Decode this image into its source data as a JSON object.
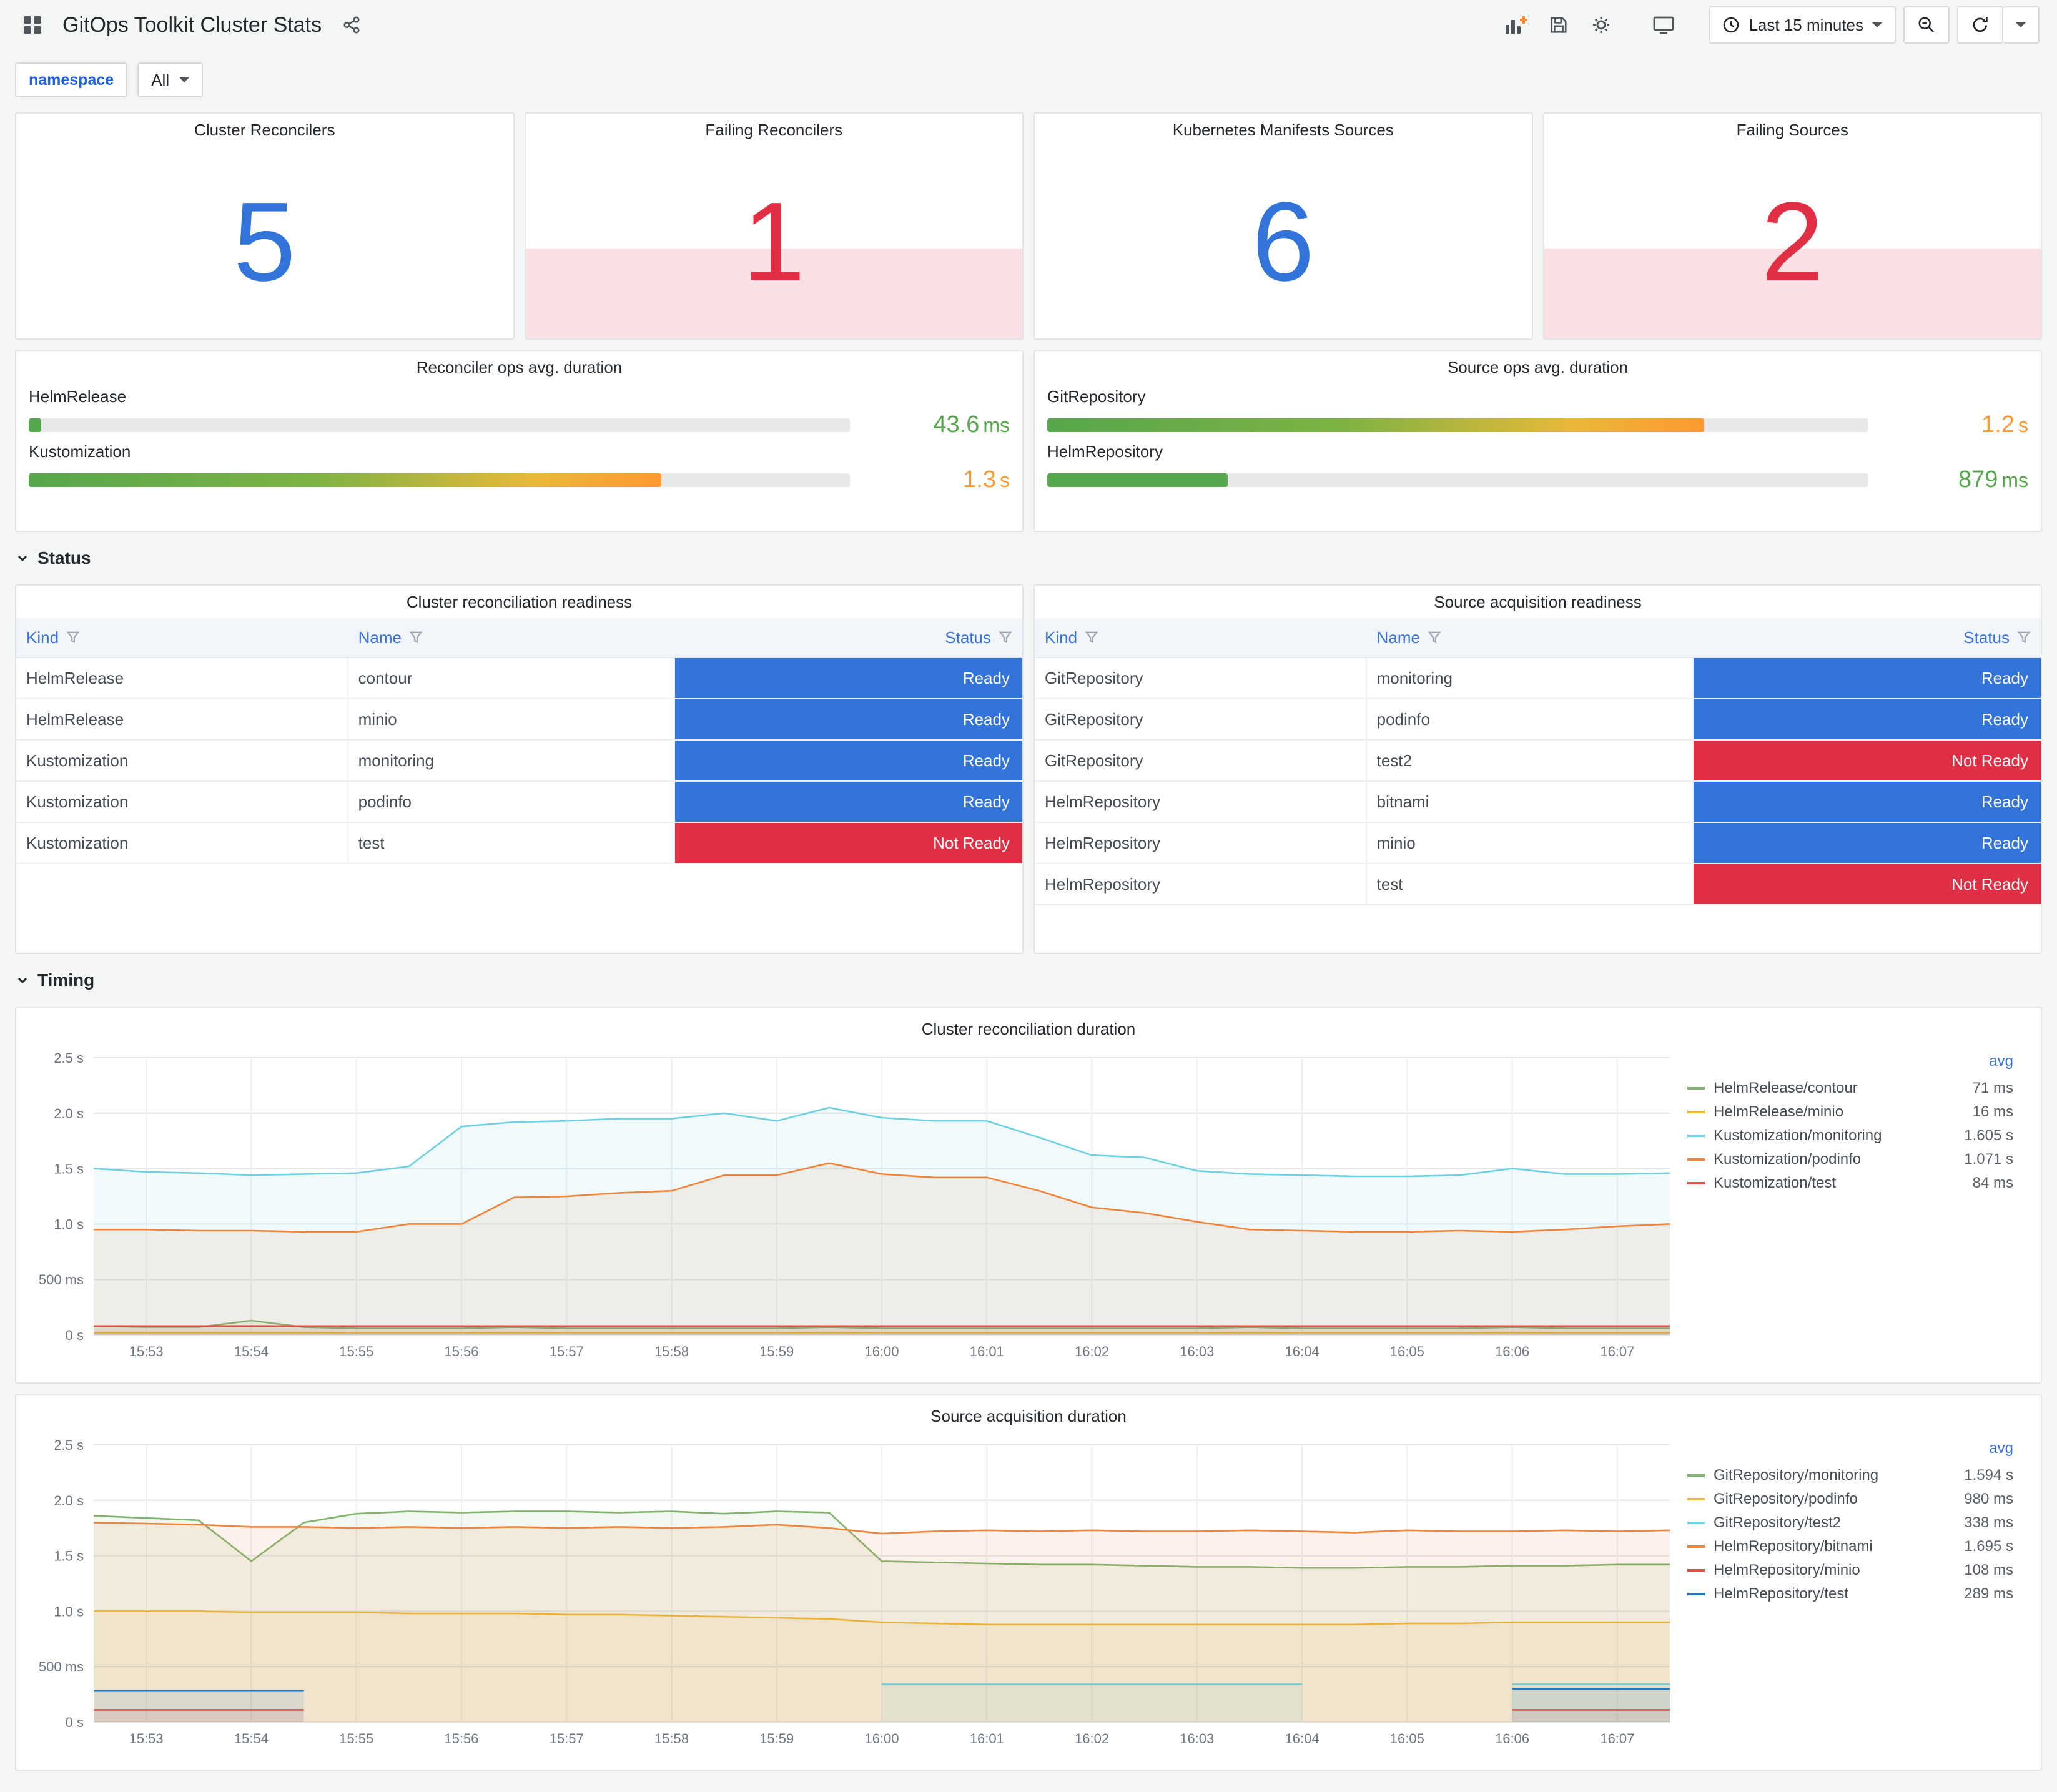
{
  "header": {
    "title": "GitOps Toolkit Cluster Stats",
    "time_label": "Last 15 minutes"
  },
  "variables": {
    "namespace_label": "namespace",
    "namespace_value": "All"
  },
  "stats": [
    {
      "title": "Cluster Reconcilers",
      "value": "5",
      "color": "#3274d9",
      "alert": false
    },
    {
      "title": "Failing Reconcilers",
      "value": "1",
      "color": "#e02f44",
      "alert": true
    },
    {
      "title": "Kubernetes Manifests Sources",
      "value": "6",
      "color": "#3274d9",
      "alert": false
    },
    {
      "title": "Failing Sources",
      "value": "2",
      "color": "#e02f44",
      "alert": true
    }
  ],
  "gauges": [
    {
      "title": "Reconciler ops avg. duration",
      "bars": [
        {
          "label": "HelmRelease",
          "value": "43.6",
          "unit": "ms",
          "pct": 1.5,
          "value_color": "#56a64b"
        },
        {
          "label": "Kustomization",
          "value": "1.3",
          "unit": "s",
          "pct": 77,
          "value_color": "#ff9830"
        }
      ]
    },
    {
      "title": "Source ops avg. duration",
      "bars": [
        {
          "label": "GitRepository",
          "value": "1.2",
          "unit": "s",
          "pct": 80,
          "value_color": "#ff9830"
        },
        {
          "label": "HelmRepository",
          "value": "879",
          "unit": "ms",
          "pct": 22,
          "value_color": "#56a64b"
        }
      ]
    }
  ],
  "sections": {
    "status": "Status",
    "timing": "Timing"
  },
  "status_colors": {
    "Ready": "#3274d9",
    "Not Ready": "#e02f44"
  },
  "tables": [
    {
      "title": "Cluster reconciliation readiness",
      "columns": [
        "Kind",
        "Name",
        "Status"
      ],
      "rows": [
        {
          "kind": "HelmRelease",
          "name": "contour",
          "status": "Ready"
        },
        {
          "kind": "HelmRelease",
          "name": "minio",
          "status": "Ready"
        },
        {
          "kind": "Kustomization",
          "name": "monitoring",
          "status": "Ready"
        },
        {
          "kind": "Kustomization",
          "name": "podinfo",
          "status": "Ready"
        },
        {
          "kind": "Kustomization",
          "name": "test",
          "status": "Not Ready"
        }
      ]
    },
    {
      "title": "Source acquisition readiness",
      "columns": [
        "Kind",
        "Name",
        "Status"
      ],
      "rows": [
        {
          "kind": "GitRepository",
          "name": "monitoring",
          "status": "Ready"
        },
        {
          "kind": "GitRepository",
          "name": "podinfo",
          "status": "Ready"
        },
        {
          "kind": "GitRepository",
          "name": "test2",
          "status": "Not Ready"
        },
        {
          "kind": "HelmRepository",
          "name": "bitnami",
          "status": "Ready"
        },
        {
          "kind": "HelmRepository",
          "name": "minio",
          "status": "Ready"
        },
        {
          "kind": "HelmRepository",
          "name": "test",
          "status": "Not Ready"
        }
      ]
    }
  ],
  "chart_data": [
    {
      "type": "line",
      "title": "Cluster reconciliation duration",
      "legend_header": "avg",
      "ylim": [
        0,
        2.5
      ],
      "x_max": 15,
      "x_step": 0.5,
      "y_ticks": [
        {
          "v": 0,
          "label": "0 s"
        },
        {
          "v": 0.5,
          "label": "500 ms"
        },
        {
          "v": 1,
          "label": "1.0 s"
        },
        {
          "v": 1.5,
          "label": "1.5 s"
        },
        {
          "v": 2,
          "label": "2.0 s"
        },
        {
          "v": 2.5,
          "label": "2.5 s"
        }
      ],
      "x_tick_labels": [
        "15:53",
        "15:54",
        "15:55",
        "15:56",
        "15:57",
        "15:58",
        "15:59",
        "16:00",
        "16:01",
        "16:02",
        "16:03",
        "16:04",
        "16:05",
        "16:06",
        "16:07"
      ],
      "series": [
        {
          "name": "HelmRelease/contour",
          "color": "#7EB26D",
          "avg": "71 ms",
          "values": [
            0.08,
            0.07,
            0.07,
            0.13,
            0.07,
            0.06,
            0.06,
            0.06,
            0.07,
            0.06,
            0.06,
            0.06,
            0.06,
            0.06,
            0.07,
            0.06,
            0.06,
            0.06,
            0.06,
            0.06,
            0.06,
            0.06,
            0.07,
            0.06,
            0.06,
            0.06,
            0.06,
            0.07,
            0.06,
            0.06,
            0.06
          ]
        },
        {
          "name": "HelmRelease/minio",
          "color": "#EAB839",
          "avg": "16 ms",
          "values": [
            0.02,
            0.02,
            0.02,
            0.02,
            0.02,
            0.02,
            0.02,
            0.02,
            0.02,
            0.02,
            0.02,
            0.02,
            0.02,
            0.02,
            0.02,
            0.02,
            0.02,
            0.02,
            0.02,
            0.02,
            0.02,
            0.02,
            0.02,
            0.02,
            0.02,
            0.02,
            0.02,
            0.02,
            0.02,
            0.02,
            0.02
          ]
        },
        {
          "name": "Kustomization/monitoring",
          "color": "#6ED0E0",
          "avg": "1.605 s",
          "values": [
            1.5,
            1.47,
            1.46,
            1.44,
            1.45,
            1.46,
            1.52,
            1.88,
            1.92,
            1.93,
            1.95,
            1.95,
            2.0,
            1.93,
            2.05,
            1.96,
            1.93,
            1.93,
            1.78,
            1.62,
            1.6,
            1.48,
            1.45,
            1.44,
            1.43,
            1.43,
            1.44,
            1.5,
            1.45,
            1.45,
            1.46
          ]
        },
        {
          "name": "Kustomization/podinfo",
          "color": "#EF843C",
          "avg": "1.071 s",
          "values": [
            0.95,
            0.95,
            0.94,
            0.94,
            0.93,
            0.93,
            1.0,
            1.0,
            1.24,
            1.25,
            1.28,
            1.3,
            1.44,
            1.44,
            1.55,
            1.45,
            1.42,
            1.42,
            1.3,
            1.15,
            1.1,
            1.02,
            0.95,
            0.94,
            0.93,
            0.93,
            0.94,
            0.93,
            0.95,
            0.98,
            1.0
          ]
        },
        {
          "name": "Kustomization/test",
          "color": "#E24D42",
          "avg": "84 ms",
          "values": [
            0.08,
            0.08,
            0.08,
            0.08,
            0.08,
            0.08,
            0.08,
            0.08,
            0.08,
            0.08,
            0.08,
            0.08,
            0.08,
            0.08,
            0.08,
            0.08,
            0.08,
            0.08,
            0.08,
            0.08,
            0.08,
            0.08,
            0.08,
            0.08,
            0.08,
            0.08,
            0.08,
            0.08,
            0.08,
            0.08,
            0.08
          ]
        }
      ]
    },
    {
      "type": "line",
      "title": "Source acquisition duration",
      "legend_header": "avg",
      "ylim": [
        0,
        2.5
      ],
      "x_max": 15,
      "x_step": 0.5,
      "y_ticks": [
        {
          "v": 0,
          "label": "0 s"
        },
        {
          "v": 0.5,
          "label": "500 ms"
        },
        {
          "v": 1,
          "label": "1.0 s"
        },
        {
          "v": 1.5,
          "label": "1.5 s"
        },
        {
          "v": 2,
          "label": "2.0 s"
        },
        {
          "v": 2.5,
          "label": "2.5 s"
        }
      ],
      "x_tick_labels": [
        "15:53",
        "15:54",
        "15:55",
        "15:56",
        "15:57",
        "15:58",
        "15:59",
        "16:00",
        "16:01",
        "16:02",
        "16:03",
        "16:04",
        "16:05",
        "16:06",
        "16:07"
      ],
      "series": [
        {
          "name": "GitRepository/monitoring",
          "color": "#7EB26D",
          "avg": "1.594 s",
          "values": [
            1.86,
            1.84,
            1.82,
            1.45,
            1.8,
            1.88,
            1.9,
            1.89,
            1.9,
            1.9,
            1.89,
            1.9,
            1.88,
            1.9,
            1.89,
            1.45,
            1.44,
            1.43,
            1.42,
            1.42,
            1.41,
            1.4,
            1.4,
            1.39,
            1.39,
            1.4,
            1.4,
            1.41,
            1.41,
            1.42,
            1.42
          ]
        },
        {
          "name": "GitRepository/podinfo",
          "color": "#EAB839",
          "avg": "980 ms",
          "values": [
            1.0,
            1.0,
            1.0,
            0.99,
            0.99,
            0.99,
            0.98,
            0.98,
            0.98,
            0.97,
            0.97,
            0.96,
            0.95,
            0.94,
            0.93,
            0.9,
            0.89,
            0.88,
            0.88,
            0.88,
            0.88,
            0.88,
            0.88,
            0.88,
            0.88,
            0.89,
            0.89,
            0.9,
            0.9,
            0.9,
            0.9
          ]
        },
        {
          "name": "GitRepository/test2",
          "color": "#6ED0E0",
          "avg": "338 ms",
          "values": [
            null,
            null,
            null,
            null,
            null,
            null,
            null,
            null,
            null,
            null,
            null,
            null,
            null,
            null,
            null,
            0.34,
            0.34,
            0.34,
            0.34,
            0.34,
            0.34,
            0.34,
            0.34,
            0.34,
            null,
            null,
            null,
            0.34,
            0.34,
            0.34,
            0.34
          ]
        },
        {
          "name": "HelmRepository/bitnami",
          "color": "#EF843C",
          "avg": "1.695 s",
          "values": [
            1.8,
            1.79,
            1.78,
            1.76,
            1.76,
            1.75,
            1.76,
            1.75,
            1.76,
            1.75,
            1.76,
            1.75,
            1.76,
            1.78,
            1.75,
            1.7,
            1.72,
            1.73,
            1.72,
            1.73,
            1.72,
            1.72,
            1.73,
            1.72,
            1.71,
            1.73,
            1.72,
            1.72,
            1.73,
            1.72,
            1.73
          ]
        },
        {
          "name": "HelmRepository/minio",
          "color": "#E24D42",
          "avg": "108 ms",
          "values": [
            0.11,
            0.11,
            0.11,
            0.11,
            0.11,
            null,
            null,
            null,
            null,
            null,
            null,
            null,
            null,
            null,
            null,
            null,
            null,
            null,
            null,
            null,
            null,
            null,
            null,
            null,
            null,
            null,
            null,
            0.11,
            0.11,
            0.11,
            0.11
          ]
        },
        {
          "name": "HelmRepository/test",
          "color": "#1F78C1",
          "avg": "289 ms",
          "values": [
            0.28,
            0.28,
            0.28,
            0.28,
            0.28,
            null,
            null,
            null,
            null,
            null,
            null,
            null,
            null,
            null,
            null,
            null,
            null,
            null,
            null,
            null,
            null,
            null,
            null,
            null,
            null,
            null,
            null,
            0.3,
            0.3,
            0.3,
            0.3
          ]
        }
      ]
    }
  ]
}
